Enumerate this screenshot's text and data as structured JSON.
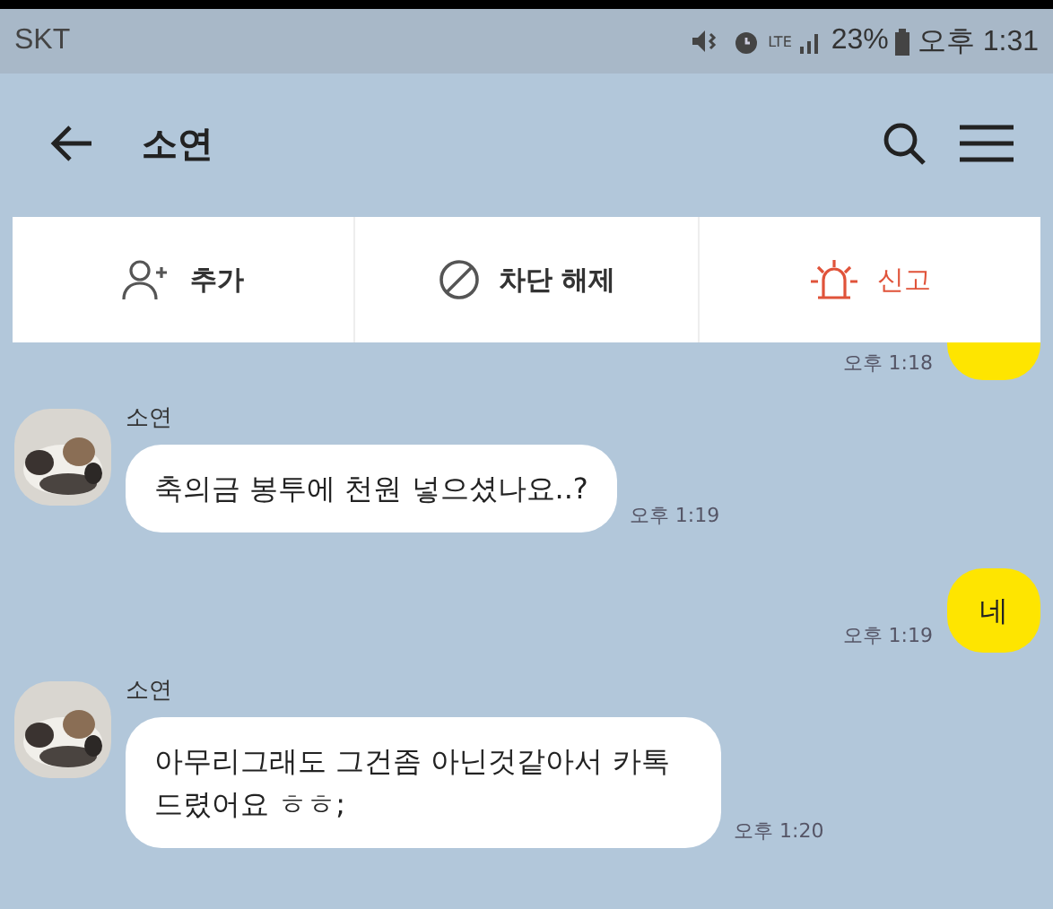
{
  "status_bar": {
    "carrier": "SKT",
    "network": "LTE",
    "battery": "23%",
    "time": "오후 1:31"
  },
  "header": {
    "title": "소연"
  },
  "actions": [
    {
      "kind": "add",
      "label": "추가"
    },
    {
      "kind": "unblock",
      "label": "차단 해제"
    },
    {
      "kind": "report",
      "label": "신고"
    }
  ],
  "messages": [
    {
      "kind": "outgoing",
      "time": "오후 1:18"
    },
    {
      "kind": "incoming",
      "sender": "소연",
      "text": "축의금 봉투에 천원 넣으셨나요..?",
      "time": "오후 1:19"
    },
    {
      "kind": "outgoing",
      "text": "네",
      "time": "오후 1:19"
    },
    {
      "kind": "incoming",
      "sender": "소연",
      "text": "아무리그래도 그건좀 아닌것같아서 카톡 드렸어요 ㅎㅎ;",
      "time": "오후 1:20"
    }
  ]
}
